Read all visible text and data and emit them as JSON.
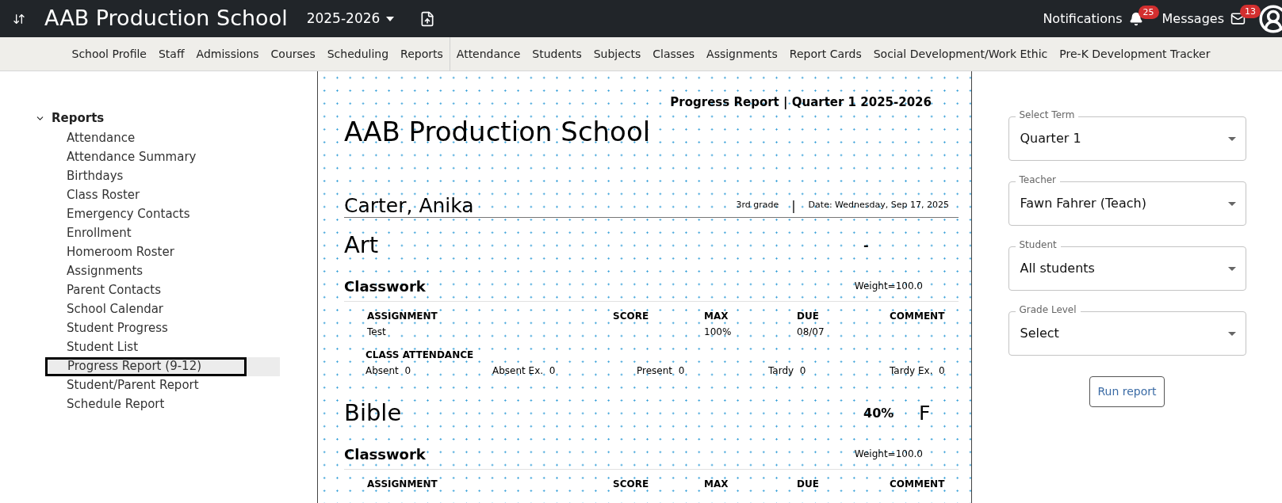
{
  "header": {
    "title": "AAB Production School",
    "year": "2025-2026",
    "notifications": {
      "label": "Notifications",
      "count": "25"
    },
    "messages": {
      "label": "Messages",
      "count": "13"
    }
  },
  "nav": {
    "groups": [
      [
        "School Profile",
        "Staff",
        "Admissions",
        "Courses",
        "Scheduling",
        "Reports"
      ],
      [
        "Attendance",
        "Students",
        "Subjects",
        "Classes",
        "Assignments",
        "Report Cards",
        "Social Development/Work Ethic",
        "Pre-K Development Tracker"
      ]
    ]
  },
  "sidebar": {
    "section": {
      "label": "Reports",
      "expanded": true,
      "items": [
        {
          "label": "Attendance",
          "selected": false
        },
        {
          "label": "Attendance Summary",
          "selected": false
        },
        {
          "label": "Birthdays",
          "selected": false
        },
        {
          "label": "Class Roster",
          "selected": false
        },
        {
          "label": "Emergency Contacts",
          "selected": false
        },
        {
          "label": "Enrollment",
          "selected": false
        },
        {
          "label": "Homeroom Roster",
          "selected": false
        },
        {
          "label": "Assignments",
          "selected": false
        },
        {
          "label": "Parent Contacts",
          "selected": false
        },
        {
          "label": "School Calendar",
          "selected": false
        },
        {
          "label": "Student Progress",
          "selected": false
        },
        {
          "label": "Student List",
          "selected": false
        },
        {
          "label": "Progress Report (9-12)",
          "selected": true
        },
        {
          "label": "Student/Parent Report",
          "selected": false
        },
        {
          "label": "Schedule Report",
          "selected": false
        }
      ]
    }
  },
  "report": {
    "heading": "Progress Report | Quarter 1 2025-2026",
    "school": "AAB Production School",
    "student": "Carter, Anika",
    "grade": "3rd grade",
    "separator": "|",
    "date": "Date: Wednesday, Sep 17, 2025",
    "subjects": [
      {
        "name": "Art",
        "percent": "-",
        "categories": [
          {
            "name": "Classwork",
            "weight": "Weight=100.0",
            "columns": [
              "ASSIGNMENT",
              "SCORE",
              "MAX",
              "DUE",
              "COMMENT"
            ],
            "assignments": [
              {
                "assignment": "Test",
                "max": "100%",
                "due": "08/07"
              }
            ]
          }
        ],
        "attendance": {
          "title": "CLASS ATTENDANCE",
          "items": [
            {
              "label": "Absent",
              "value": "0"
            },
            {
              "label": "Absent Ex.",
              "value": "0"
            },
            {
              "label": "Present",
              "value": "0"
            },
            {
              "label": "Tardy",
              "value": "0"
            },
            {
              "label": "Tardy Ex.",
              "value": "0"
            }
          ]
        }
      },
      {
        "name": "Bible",
        "percent": "40%",
        "letter": "F",
        "categories": [
          {
            "name": "Classwork",
            "weight": "Weight=100.0",
            "columns": [
              "ASSIGNMENT",
              "SCORE",
              "MAX",
              "DUE",
              "COMMENT"
            ]
          }
        ]
      }
    ]
  },
  "filters": [
    {
      "label": "Select Term",
      "value": "Quarter 1"
    },
    {
      "label": "Teacher",
      "value": "Fawn Fahrer (Teach)"
    },
    {
      "label": "Student",
      "value": "All students"
    },
    {
      "label": "Grade Level",
      "value": "Select"
    }
  ],
  "run_button": "Run report"
}
